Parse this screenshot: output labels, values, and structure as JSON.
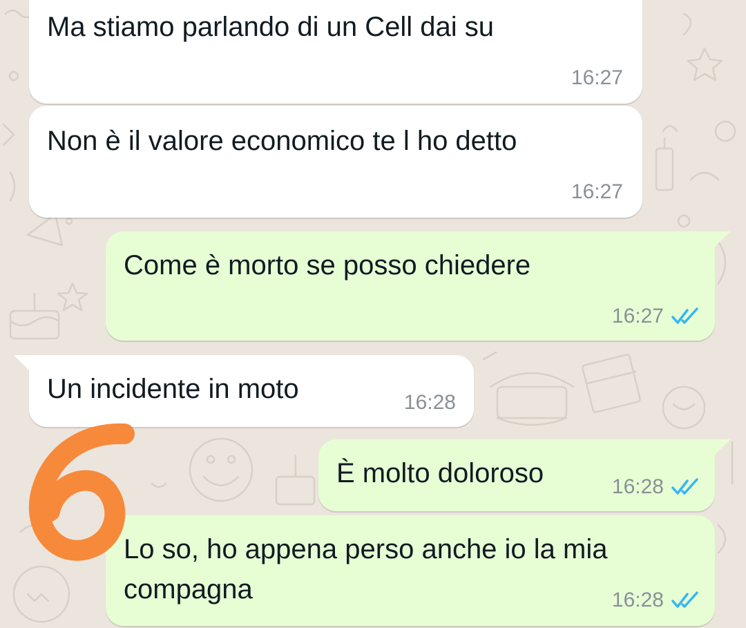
{
  "colors": {
    "chat_background": "#ece5dd",
    "incoming_bubble": "#ffffff",
    "outgoing_bubble": "#e7fed5",
    "read_ticks": "#34b7f1",
    "timestamp": "#8a9096",
    "annotation_stroke": "#f7893b"
  },
  "messages": [
    {
      "direction": "incoming",
      "text": "Ma stiamo parlando di un Cell dai su",
      "time": "16:27"
    },
    {
      "direction": "incoming",
      "text": "Non è il valore economico te l ho detto",
      "time": "16:27"
    },
    {
      "direction": "outgoing",
      "text": "Come è morto se posso chiedere",
      "time": "16:27",
      "status": "read-double-check-icon"
    },
    {
      "direction": "incoming",
      "text": "Un incidente in moto",
      "time": "16:28"
    },
    {
      "direction": "outgoing",
      "text": "È molto doloroso",
      "time": "16:28",
      "status": "read-double-check-icon"
    },
    {
      "direction": "outgoing",
      "text": "Lo so, ho appena perso anche io la mia\ncompagna",
      "time": "16:28",
      "status": "read-double-check-icon"
    }
  ],
  "annotation": {
    "label": "6",
    "kind": "handwritten-number"
  }
}
